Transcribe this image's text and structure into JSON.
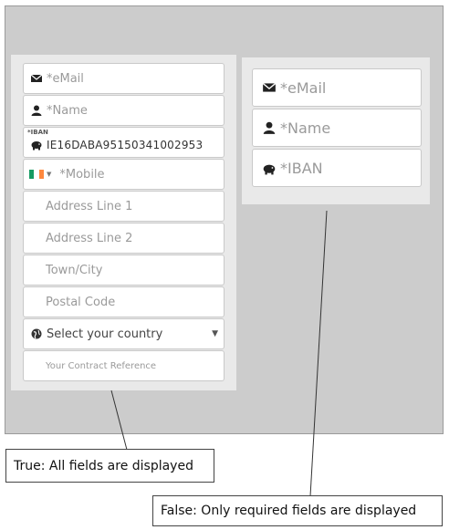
{
  "full_form": {
    "email_placeholder": "*eMail",
    "name_placeholder": "*Name",
    "iban_label": "*IBAN",
    "iban_value": "IE16DABA95150341002953",
    "mobile_placeholder": "*Mobile",
    "address1_placeholder": "Address Line 1",
    "address2_placeholder": "Address Line 2",
    "town_placeholder": "Town/City",
    "postal_placeholder": "Postal Code",
    "country_selected": "Select your country",
    "contract_placeholder": "Your Contract Reference"
  },
  "required_form": {
    "email_placeholder": "*eMail",
    "name_placeholder": "*Name",
    "iban_placeholder": "*IBAN"
  },
  "callouts": {
    "true_label": "True: All fields are displayed",
    "false_label": "False: Only required fields are displayed"
  },
  "icons": [
    "envelope-icon",
    "person-icon",
    "piggy-bank-icon",
    "ireland-flag-icon",
    "globe-icon",
    "chevron-down-icon"
  ],
  "colors": {
    "background_area": "#cccccc",
    "panel": "#e9e9e9",
    "flag_green": "#169b62",
    "flag_orange": "#ff883e"
  }
}
